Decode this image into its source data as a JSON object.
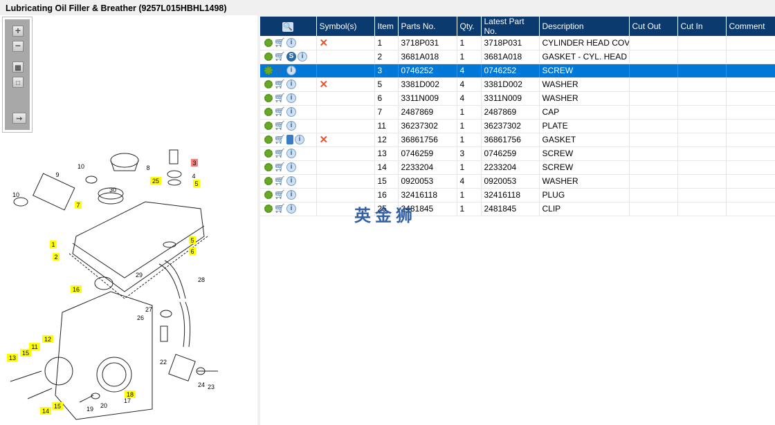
{
  "title": "Lubricating Oil Filler & Breather (9257L015HBHL1498)",
  "toolbar": {
    "zoom_in": "+",
    "zoom_out": "−"
  },
  "columns": [
    "",
    "Symbol(s)",
    "Item",
    "Parts No.",
    "Qty.",
    "Latest Part No.",
    "Description",
    "Cut Out",
    "Cut In",
    "Comment"
  ],
  "rows": [
    {
      "symbol": "✕",
      "item": "1",
      "part": "3718P031",
      "qty": "1",
      "latest": "3718P031",
      "desc": "CYLINDER HEAD COVER",
      "s": false,
      "book": false
    },
    {
      "symbol": "",
      "item": "2",
      "part": "3681A018",
      "qty": "1",
      "latest": "3681A018",
      "desc": "GASKET - CYL. HEAD COVER",
      "s": true,
      "book": false
    },
    {
      "symbol": "",
      "item": "3",
      "part": "0746252",
      "qty": "4",
      "latest": "0746252",
      "desc": "SCREW",
      "s": false,
      "book": false,
      "selected": true
    },
    {
      "symbol": "✕",
      "item": "5",
      "part": "3381D002",
      "qty": "4",
      "latest": "3381D002",
      "desc": "WASHER",
      "s": false,
      "book": false
    },
    {
      "symbol": "",
      "item": "6",
      "part": "3311N009",
      "qty": "4",
      "latest": "3311N009",
      "desc": "WASHER",
      "s": false,
      "book": false
    },
    {
      "symbol": "",
      "item": "7",
      "part": "2487869",
      "qty": "1",
      "latest": "2487869",
      "desc": "CAP",
      "s": false,
      "book": false
    },
    {
      "symbol": "",
      "item": "11",
      "part": "36237302",
      "qty": "1",
      "latest": "36237302",
      "desc": "PLATE",
      "s": false,
      "book": false
    },
    {
      "symbol": "✕",
      "item": "12",
      "part": "36861756",
      "qty": "1",
      "latest": "36861756",
      "desc": "GASKET",
      "s": false,
      "book": true
    },
    {
      "symbol": "",
      "item": "13",
      "part": "0746259",
      "qty": "3",
      "latest": "0746259",
      "desc": "SCREW",
      "s": false,
      "book": false
    },
    {
      "symbol": "",
      "item": "14",
      "part": "2233204",
      "qty": "1",
      "latest": "2233204",
      "desc": "SCREW",
      "s": false,
      "book": false
    },
    {
      "symbol": "",
      "item": "15",
      "part": "0920053",
      "qty": "4",
      "latest": "0920053",
      "desc": "WASHER",
      "s": false,
      "book": false
    },
    {
      "symbol": "",
      "item": "16",
      "part": "32416118",
      "qty": "1",
      "latest": "32416118",
      "desc": "PLUG",
      "s": false,
      "book": false
    },
    {
      "symbol": "",
      "item": "25",
      "part": "2481845",
      "qty": "1",
      "latest": "2481845",
      "desc": "CLIP",
      "s": false,
      "book": false
    }
  ],
  "callouts": [
    "3",
    "8",
    "10",
    "9",
    "25",
    "4",
    "5",
    "30",
    "10",
    "7",
    "1",
    "2",
    "5",
    "6",
    "29",
    "28",
    "16",
    "27",
    "26",
    "12",
    "11",
    "15",
    "13",
    "22",
    "24",
    "23",
    "18",
    "17",
    "19",
    "20",
    "14",
    "15"
  ],
  "watermark": "英金狮",
  "colors": {
    "header": "#0b3a6e",
    "selected": "#0078d7",
    "highlight": "#ffff00",
    "callout_red": "#f08080"
  }
}
